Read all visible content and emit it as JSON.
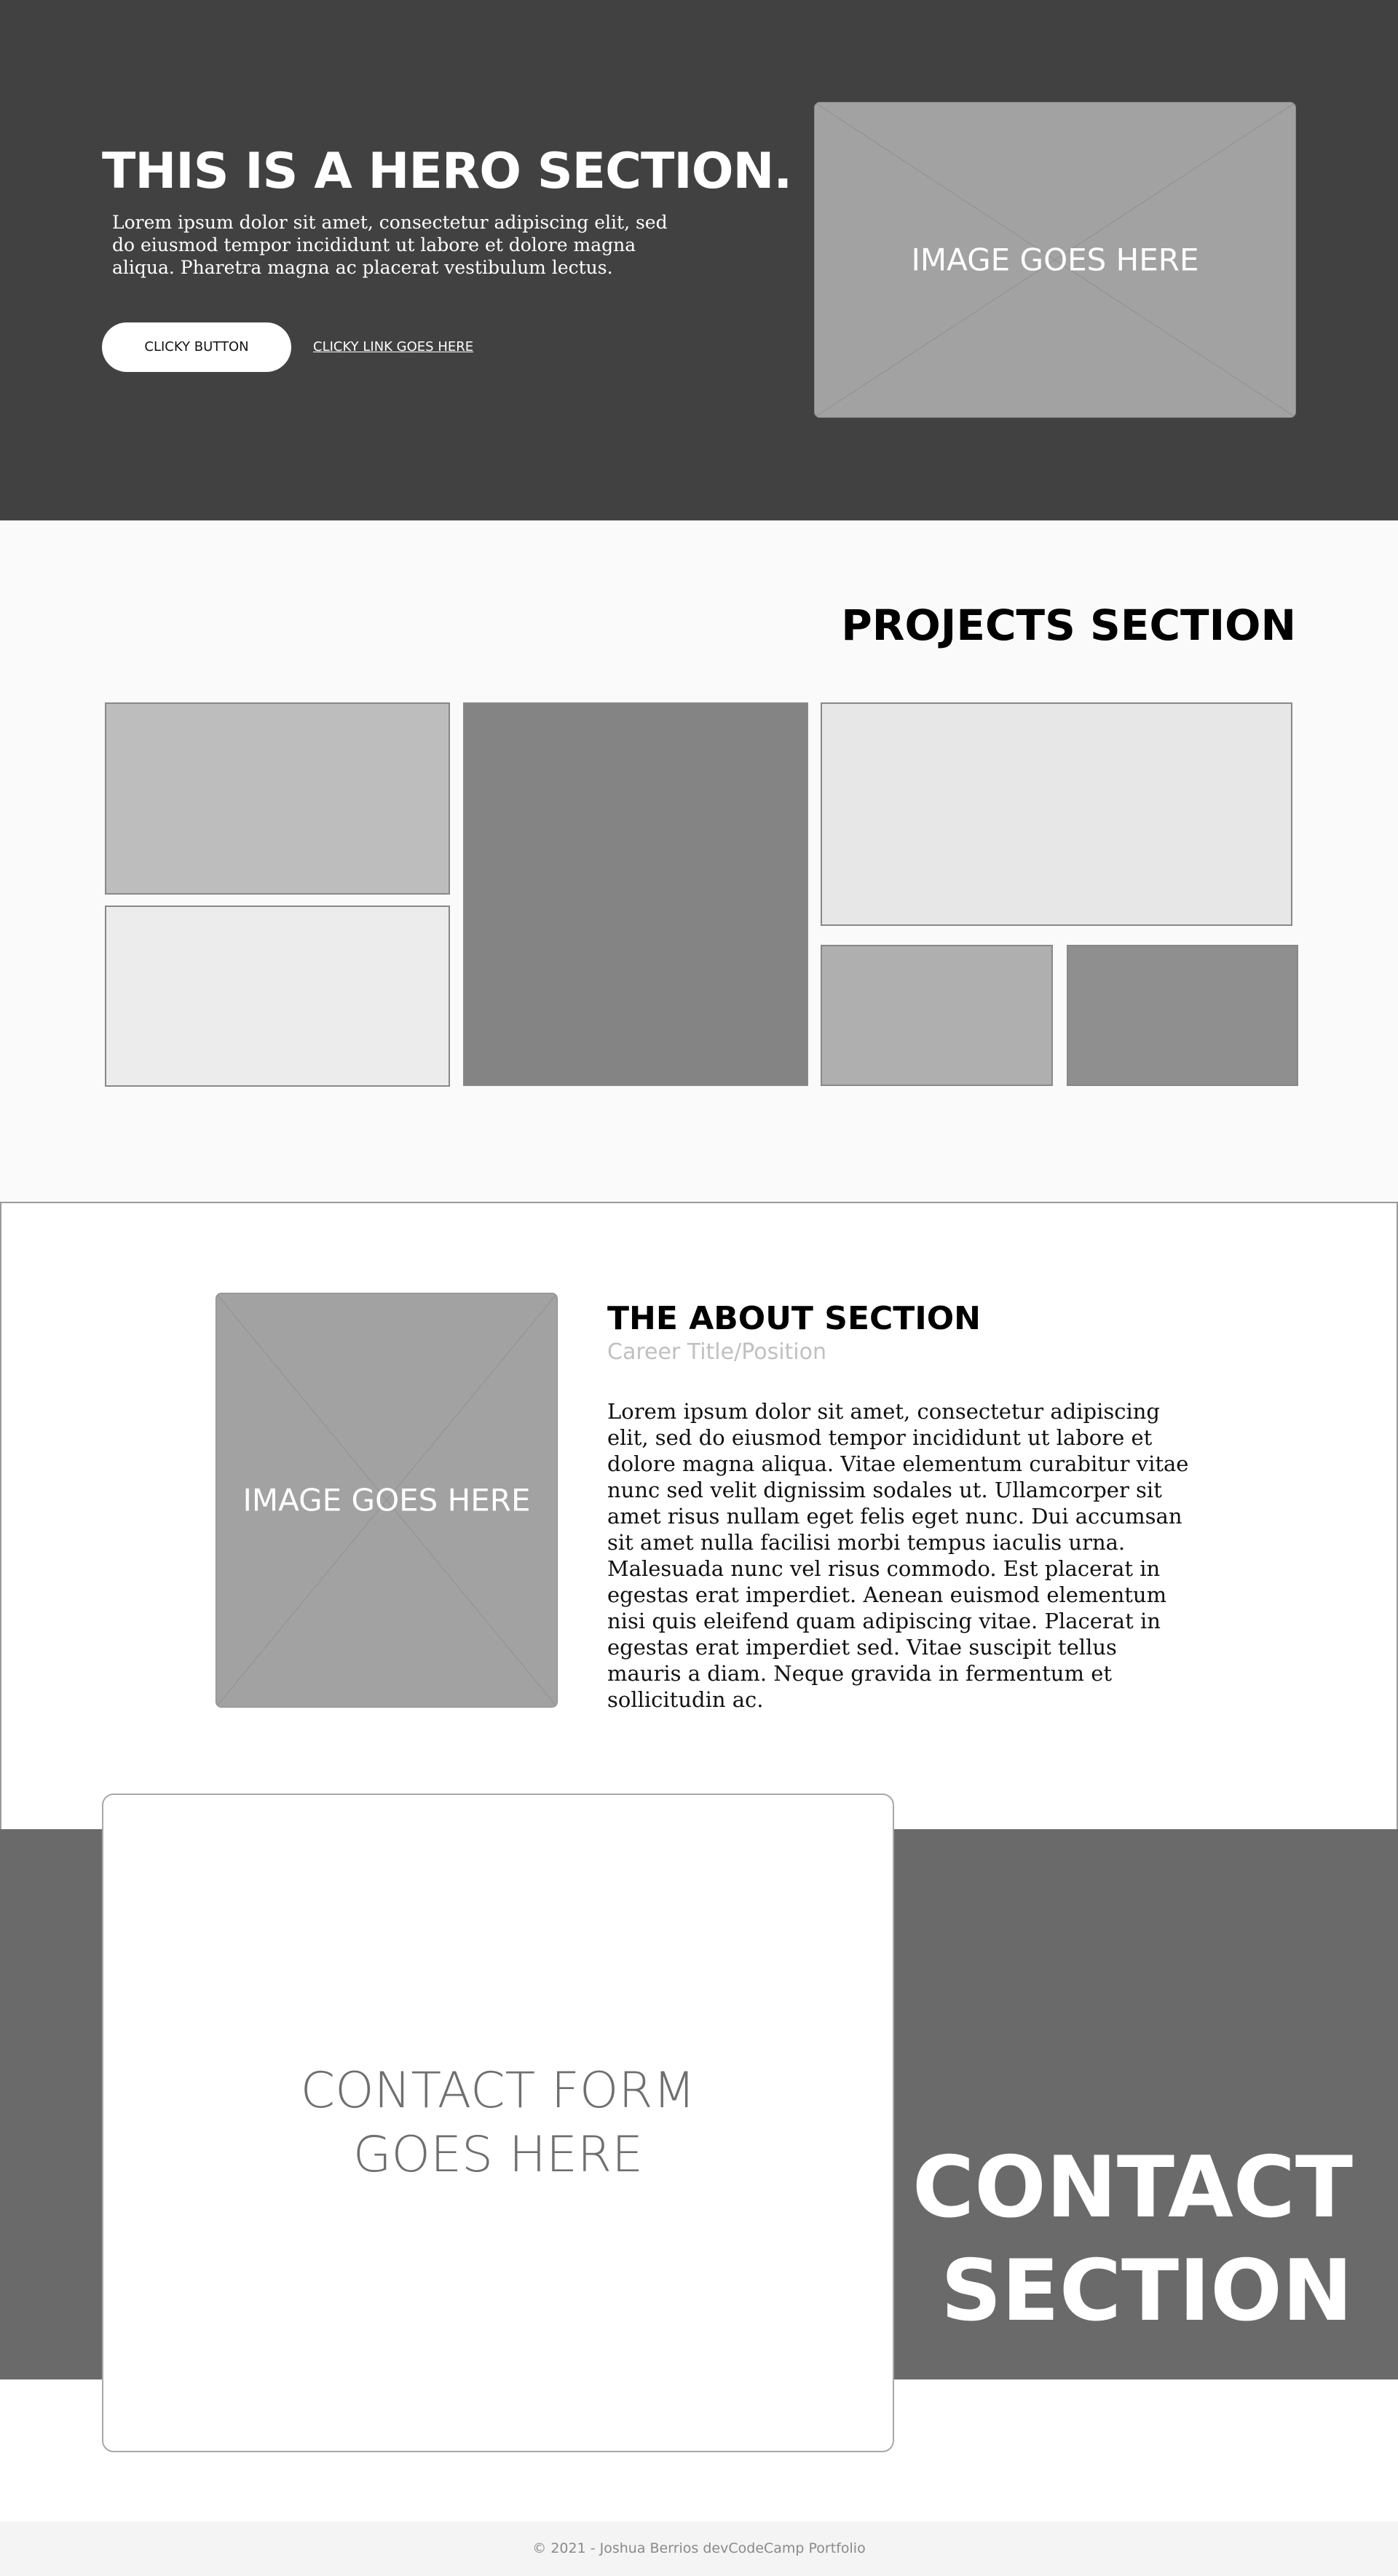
{
  "hero": {
    "title": "THIS IS A HERO SECTION.",
    "text": "Lorem ipsum dolor sit amet, consectetur adipiscing elit, sed do eiusmod tempor incididunt ut labore et dolore magna aliqua. Pharetra magna ac placerat vestibulum lectus.",
    "button_label": "CLICKY BUTTON",
    "link_label": "CLICKY LINK GOES HERE",
    "image_label": "IMAGE GOES HERE"
  },
  "projects": {
    "title": "PROJECTS SECTION",
    "tile_colors": [
      "#bdbdbd",
      "#ececec",
      "#848484",
      "#e7e7e7",
      "#afafaf",
      "#8f8f8f"
    ]
  },
  "about": {
    "image_label": "IMAGE GOES HERE",
    "title": "THE ABOUT SECTION",
    "subtitle": "Career Title/Position",
    "text": "Lorem ipsum dolor sit amet, consectetur adipiscing elit, sed do eiusmod tempor incididunt ut labore et dolore magna aliqua. Vitae elementum curabitur vitae nunc sed velit dignissim sodales ut. Ullamcorper sit amet risus nullam eget felis eget nunc. Dui accumsan sit amet nulla facilisi morbi tempus iaculis urna. Malesuada nunc vel risus commodo. Est placerat in egestas erat imperdiet. Aenean euismod elementum nisi quis eleifend quam adipiscing vitae. Placerat in egestas erat imperdiet sed. Vitae suscipit tellus mauris a diam. Neque gravida in fermentum et sollicitudin ac."
  },
  "contact": {
    "form_label": "CONTACT FORM GOES HERE",
    "title": "CONTACT SECTION"
  },
  "footer": {
    "text": "© 2021 - Joshua Berrios devCodeCamp Portfolio"
  },
  "colors": {
    "hero_bg": "#414141",
    "projects_bg": "#fafafa",
    "contact_bg": "#6a6a6a",
    "placeholder_gray": "#a2a2a2"
  }
}
